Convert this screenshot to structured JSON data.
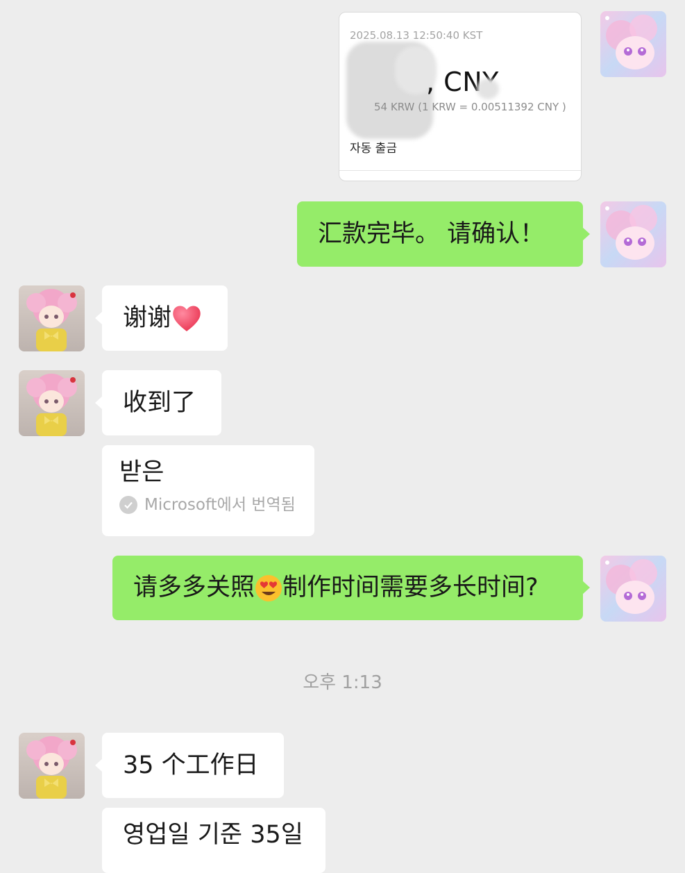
{
  "transfer_card": {
    "timestamp": "2025.08.13 12:50:40 KST",
    "amount": ", CNY",
    "rate": "54 KRW (1 KRW = 0.00511392 CNY )",
    "note": "자동 출금"
  },
  "messages": [
    {
      "text": "汇款完毕。 请确认！"
    },
    {
      "text": "谢谢"
    },
    {
      "text": "收到了"
    },
    {
      "text": "받은",
      "source": "Microsoft에서 번역됨"
    },
    {
      "text_before": "请多多关照",
      "text_after": "制作时间需要多长时间?"
    },
    {
      "text": "35 个工作日"
    },
    {
      "text": "영업일 기준 35일"
    }
  ],
  "time_divider": "오후 1:13",
  "colors": {
    "outgoing_bubble": "#95ec69",
    "incoming_bubble": "#ffffff",
    "background": "#ededed"
  },
  "icons": [
    "heart-emoji",
    "heart-eyes-emoji",
    "check-circle-icon"
  ]
}
